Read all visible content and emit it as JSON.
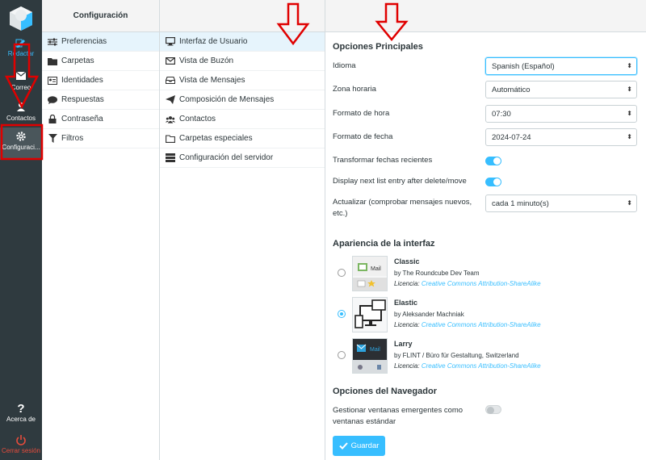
{
  "nav": {
    "compose_label": "Redactar",
    "mail_label": "Correo",
    "contacts_label": "Contactos",
    "settings_label": "Configuraci...",
    "about_label": "Acerca de",
    "logout_label": "Cerrar sesión"
  },
  "col1": {
    "title": "Configuración",
    "items": [
      {
        "label": "Preferencias",
        "icon": "sliders-icon"
      },
      {
        "label": "Carpetas",
        "icon": "folder-icon"
      },
      {
        "label": "Identidades",
        "icon": "id-card-icon"
      },
      {
        "label": "Respuestas",
        "icon": "comment-icon"
      },
      {
        "label": "Contraseña",
        "icon": "lock-icon"
      },
      {
        "label": "Filtros",
        "icon": "filter-icon"
      }
    ]
  },
  "col2": {
    "items": [
      {
        "label": "Interfaz de Usuario",
        "icon": "monitor-icon"
      },
      {
        "label": "Vista de Buzón",
        "icon": "envelope-icon"
      },
      {
        "label": "Vista de Mensajes",
        "icon": "inbox-icon"
      },
      {
        "label": "Composición de Mensajes",
        "icon": "paper-plane-icon"
      },
      {
        "label": "Contactos",
        "icon": "users-icon"
      },
      {
        "label": "Carpetas especiales",
        "icon": "folder-icon"
      },
      {
        "label": "Configuración del servidor",
        "icon": "server-icon"
      }
    ]
  },
  "main": {
    "section1_title": "Opciones Principales",
    "language_label": "Idioma",
    "language_value": "Spanish (Español)",
    "timezone_label": "Zona horaria",
    "timezone_value": "Automático",
    "time_format_label": "Formato de hora",
    "time_format_value": "07:30",
    "date_format_label": "Formato de fecha",
    "date_format_value": "2024-07-24",
    "pretty_dates_label": "Transformar fechas recientes",
    "pretty_dates_on": true,
    "next_entry_label": "Display next list entry after delete/move",
    "next_entry_on": true,
    "refresh_label": "Actualizar (comprobar mensajes nuevos, etc.)",
    "refresh_value": "cada 1 minuto(s)",
    "section2_title": "Apariencia de la interfaz",
    "skins": [
      {
        "name": "Classic",
        "author": "by The Roundcube Dev Team",
        "license_prefix": "Licencia:",
        "license": "Creative Commons Attribution-ShareAlike",
        "selected": false,
        "thumb_text": "Mail"
      },
      {
        "name": "Elastic",
        "author": "by Aleksander Machniak",
        "license_prefix": "Licencia:",
        "license": "Creative Commons Attribution-ShareAlike",
        "selected": true
      },
      {
        "name": "Larry",
        "author": "by FLINT / Büro für Gestaltung, Switzerland",
        "license_prefix": "Licencia:",
        "license": "Creative Commons Attribution-ShareAlike",
        "selected": false,
        "thumb_text": "Mail"
      }
    ],
    "section3_title": "Opciones del Navegador",
    "popup_label": "Gestionar ventanas emergentes como ventanas estándar",
    "popup_on": false,
    "save_label": "Guardar"
  },
  "colors": {
    "accent": "#37beff",
    "nav_bg": "#2f3a3f",
    "annotation": "#e00000"
  }
}
